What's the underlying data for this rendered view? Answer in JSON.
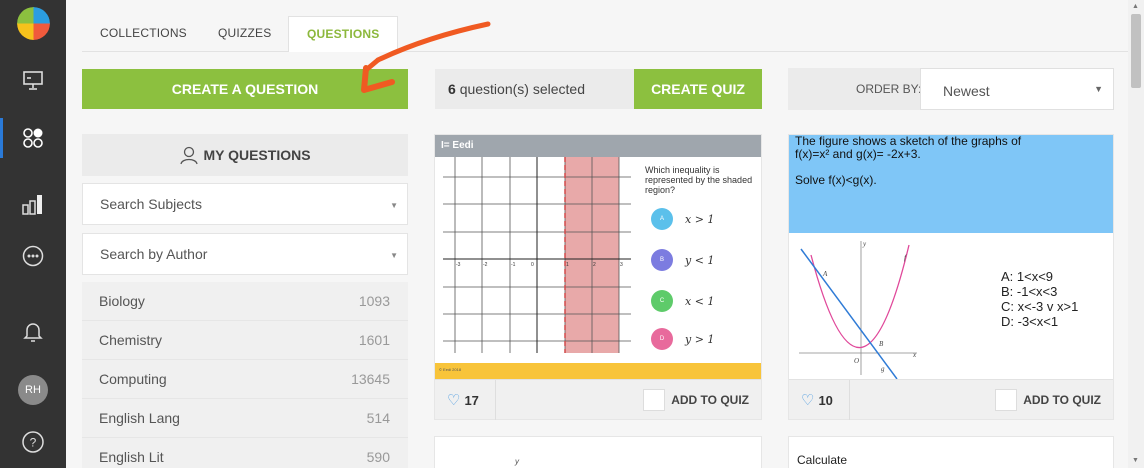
{
  "sidebar": {
    "items": [
      {
        "name": "presentation-icon",
        "glyph": "⛶"
      },
      {
        "name": "grid-dots-icon",
        "glyph": "⚬⚬"
      },
      {
        "name": "bar-chart-icon",
        "glyph": "▯▮"
      },
      {
        "name": "more-icon",
        "glyph": "⋯"
      },
      {
        "name": "bell-icon",
        "glyph": "🔔"
      },
      {
        "name": "help-icon",
        "glyph": "?"
      }
    ],
    "avatar_initials": "RH",
    "help_glyph": "?"
  },
  "tabs": [
    "COLLECTIONS",
    "QUIZZES",
    "QUESTIONS"
  ],
  "active_tab": "QUESTIONS",
  "left": {
    "create_question": "CREATE A QUESTION",
    "my_questions": "MY QUESTIONS",
    "search_subjects": "Search Subjects",
    "search_author": "Search by Author",
    "subjects": [
      {
        "name": "Biology",
        "count": "1093"
      },
      {
        "name": "Chemistry",
        "count": "1601"
      },
      {
        "name": "Computing",
        "count": "13645"
      },
      {
        "name": "English Lang",
        "count": "514"
      },
      {
        "name": "English Lit",
        "count": "590"
      }
    ]
  },
  "selection": {
    "count": "6",
    "label": "question(s) selected",
    "create_quiz": "CREATE QUIZ"
  },
  "order": {
    "label": "ORDER BY:",
    "value": "Newest"
  },
  "cards": [
    {
      "brand": "I= Eedi",
      "question": "Which inequality is represented by the shaded region?",
      "options": [
        {
          "letter": "A",
          "text": "x > 1",
          "color": "#5bc0eb"
        },
        {
          "letter": "B",
          "text": "y < 1",
          "color": "#7c7ce0"
        },
        {
          "letter": "C",
          "text": "x < 1",
          "color": "#5ecb6a"
        },
        {
          "letter": "D",
          "text": "y > 1",
          "color": "#e86a9c"
        }
      ],
      "axis_labels": [
        "-3",
        "-2",
        "-1",
        "0",
        "1",
        "2",
        "3"
      ],
      "footer_note": "© Eedi 2018",
      "likes": "17",
      "add": "ADD TO QUIZ"
    },
    {
      "text_lines": [
        "The figure shows a sketch of the graphs of",
        "f(x)=x² and g(x)= -2x+3.",
        "",
        "Solve f(x)<g(x)."
      ],
      "answers": [
        "A:  1<x<9",
        "B:  -1<x<3",
        "C:  x<-3 v x>1",
        "D:  -3<x<1"
      ],
      "graph_labels": {
        "y": "y",
        "x": "x",
        "a": "A",
        "b": "B",
        "o": "O",
        "f": "f",
        "g": "g"
      },
      "likes": "10",
      "add": "ADD TO QUIZ"
    },
    {
      "peek": "y"
    },
    {
      "peek": "Calculate"
    }
  ],
  "colors": {
    "green": "#8cc03f",
    "sidebar": "#333333",
    "accent_blue": "#2a7ad8",
    "arrow": "#f05a22"
  }
}
